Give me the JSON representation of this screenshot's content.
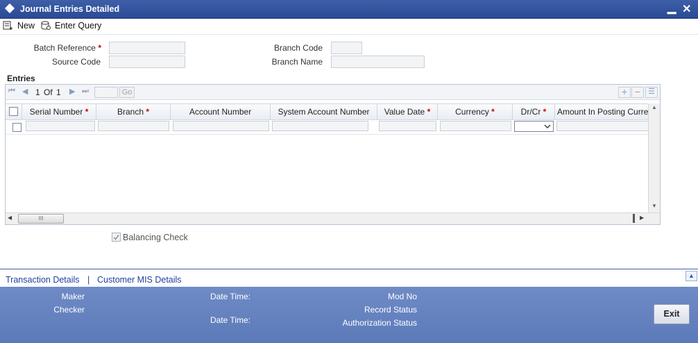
{
  "window": {
    "title": "Journal Entries Detailed",
    "minimize": "▁",
    "close": "✕"
  },
  "toolbar": {
    "new_label": "New",
    "enter_query_label": "Enter Query"
  },
  "header_fields": {
    "batch_reference": "Batch Reference",
    "source_code": "Source Code",
    "branch_code": "Branch Code",
    "branch_name": "Branch Name",
    "required_mark": "*"
  },
  "entries": {
    "section_title": "Entries",
    "pager": {
      "current": "1",
      "of_label": "Of",
      "total": "1",
      "go_label": "Go"
    },
    "columns": [
      {
        "label": "Serial Number",
        "required": "*"
      },
      {
        "label": "Branch",
        "required": "*"
      },
      {
        "label": "Account Number",
        "required": ""
      },
      {
        "label": "System Account Number",
        "required": ""
      },
      {
        "label": "Value Date",
        "required": "*"
      },
      {
        "label": "Currency",
        "required": "*"
      },
      {
        "label": "Dr/Cr",
        "required": "*"
      },
      {
        "label": "Amount In Posting Curre",
        "required": ""
      }
    ],
    "scroll_thumb": "III"
  },
  "balancing_check": {
    "label": "Balancing Check",
    "checked": true
  },
  "tabs": {
    "transaction_details": "Transaction Details",
    "separator": "|",
    "customer_mis": "Customer MIS Details"
  },
  "audit": {
    "maker": "Maker",
    "checker": "Checker",
    "date_time_1": "Date Time:",
    "date_time_2": "Date Time:",
    "mod_no": "Mod No",
    "record_status": "Record Status",
    "authorization_status": "Authorization Status",
    "exit_label": "Exit"
  },
  "colors": {
    "title_bar": "#2b4a95",
    "audit_bar": "#6382bf",
    "link": "#1f3f9c",
    "required": "#cc0000"
  }
}
